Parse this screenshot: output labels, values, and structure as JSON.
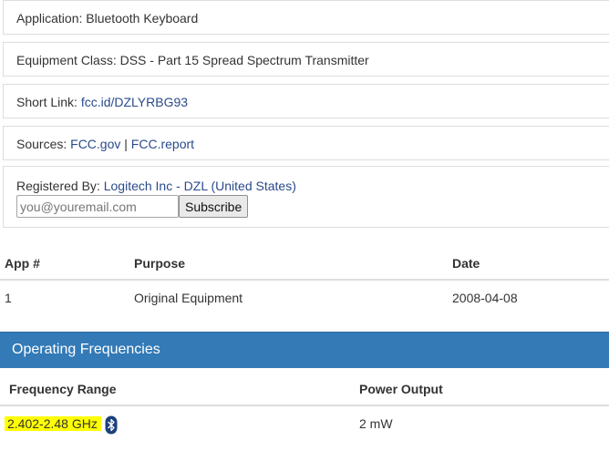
{
  "info": {
    "application": {
      "label": "Application:",
      "value": "Bluetooth Keyboard"
    },
    "equipment_class": {
      "label": "Equipment Class:",
      "value": "DSS - Part 15 Spread Spectrum Transmitter"
    },
    "short_link": {
      "label": "Short Link:",
      "link": "fcc.id/DZLYRBG93"
    },
    "sources": {
      "label": "Sources:",
      "link1": "FCC.gov",
      "separator": "|",
      "link2": "FCC.report"
    },
    "registered_by": {
      "label": "Registered By:",
      "company": "Logitech Inc - DZL",
      "paren_open": "(",
      "country": "United States",
      "paren_close": ")"
    }
  },
  "subscribe": {
    "placeholder": "you@youremail.com",
    "button_label": "Subscribe"
  },
  "applications_table": {
    "headers": [
      "App #",
      "Purpose",
      "Date"
    ],
    "rows": [
      {
        "app": "1",
        "purpose": "Original Equipment",
        "date": "2008-04-08"
      }
    ]
  },
  "operating_frequencies": {
    "title": "Operating Frequencies",
    "headers": [
      "Frequency Range",
      "Power Output"
    ],
    "rows": [
      {
        "range": "2.402-2.48 GHz",
        "icon": "bluetooth-icon",
        "power": "2 mW"
      }
    ]
  },
  "colors": {
    "panel_header": "#337ab7",
    "highlight": "#ffff00",
    "link": "#2a4a8c",
    "bluetooth_badge": "#1b3f7a"
  }
}
